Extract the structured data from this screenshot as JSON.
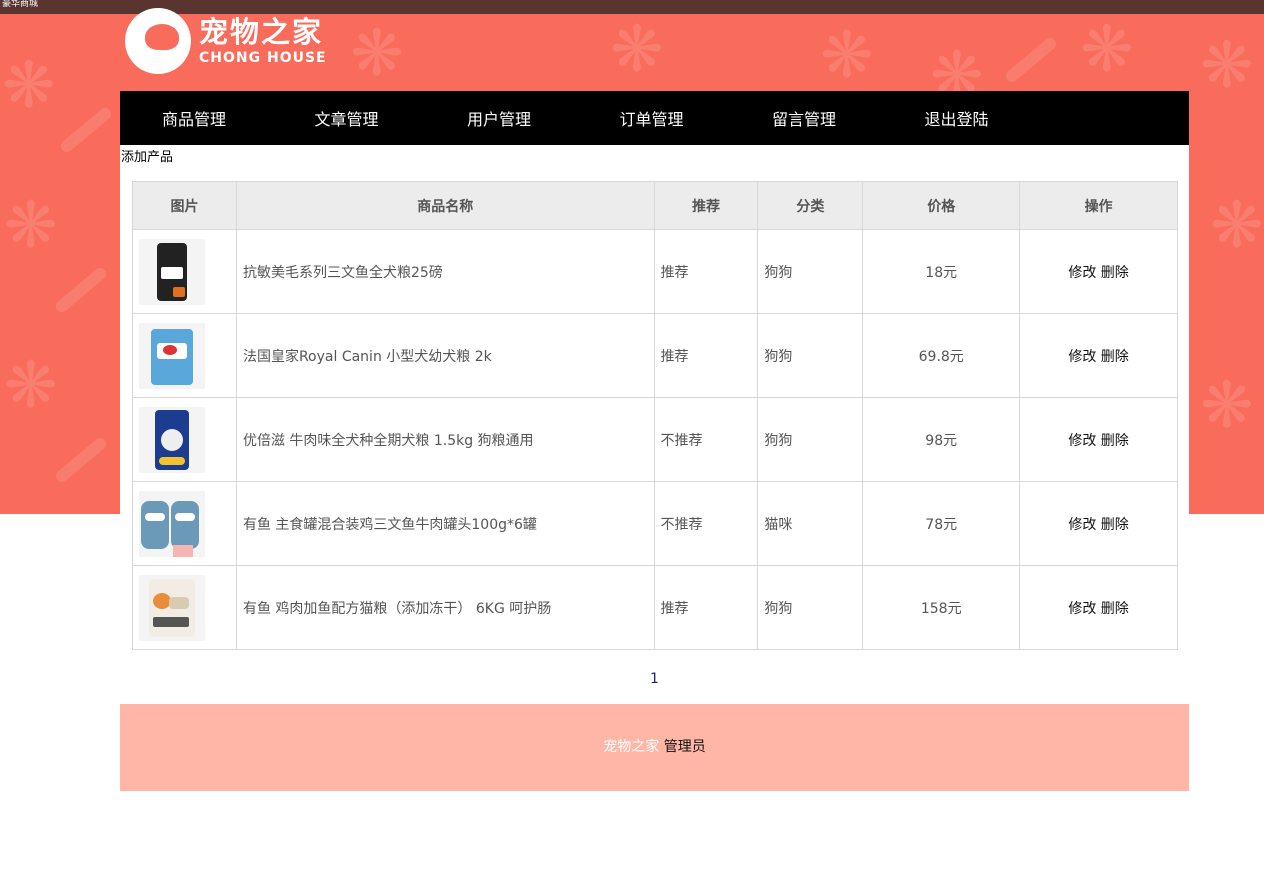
{
  "window": {
    "title": "豪华商城"
  },
  "logo": {
    "cn": "宠物之家",
    "en": "CHONG HOUSE"
  },
  "nav": {
    "items": [
      {
        "label": "商品管理"
      },
      {
        "label": "文章管理"
      },
      {
        "label": "用户管理"
      },
      {
        "label": "订单管理"
      },
      {
        "label": "留言管理"
      },
      {
        "label": "退出登陆"
      }
    ]
  },
  "actions": {
    "add_product": "添加产品"
  },
  "table": {
    "headers": [
      "图片",
      "商品名称",
      "推荐",
      "分类",
      "价格",
      "操作"
    ],
    "rows": [
      {
        "name": "抗敏美毛系列三文鱼全犬粮25磅",
        "recommend": "推荐",
        "category": "狗狗",
        "price": "18元",
        "edit": "修改",
        "delete": "删除",
        "img": "dark-bag"
      },
      {
        "name": "法国皇家Royal Canin 小型犬幼犬粮 2k",
        "recommend": "推荐",
        "category": "狗狗",
        "price": "69.8元",
        "edit": "修改",
        "delete": "删除",
        "img": "blue-bag"
      },
      {
        "name": "优倍滋 牛肉味全犬种全期犬粮 1.5kg 狗粮通用",
        "recommend": "不推荐",
        "category": "狗狗",
        "price": "98元",
        "edit": "修改",
        "delete": "删除",
        "img": "navy-bag"
      },
      {
        "name": "有鱼 主食罐混合装鸡三文鱼牛肉罐头100g*6罐",
        "recommend": "不推荐",
        "category": "猫咪",
        "price": "78元",
        "edit": "修改",
        "delete": "删除",
        "img": "cans"
      },
      {
        "name": "有鱼 鸡肉加鱼配方猫粮（添加冻干） 6KG 呵护肠",
        "recommend": "推荐",
        "category": "狗狗",
        "price": "158元",
        "edit": "修改",
        "delete": "删除",
        "img": "white-box"
      }
    ]
  },
  "pagination": {
    "current": "1"
  },
  "footer": {
    "site": "宠物之家",
    "role": "管理员"
  },
  "colors": {
    "brand": "#f96b5b",
    "footer": "#ffb6a7",
    "nav": "#000000"
  }
}
